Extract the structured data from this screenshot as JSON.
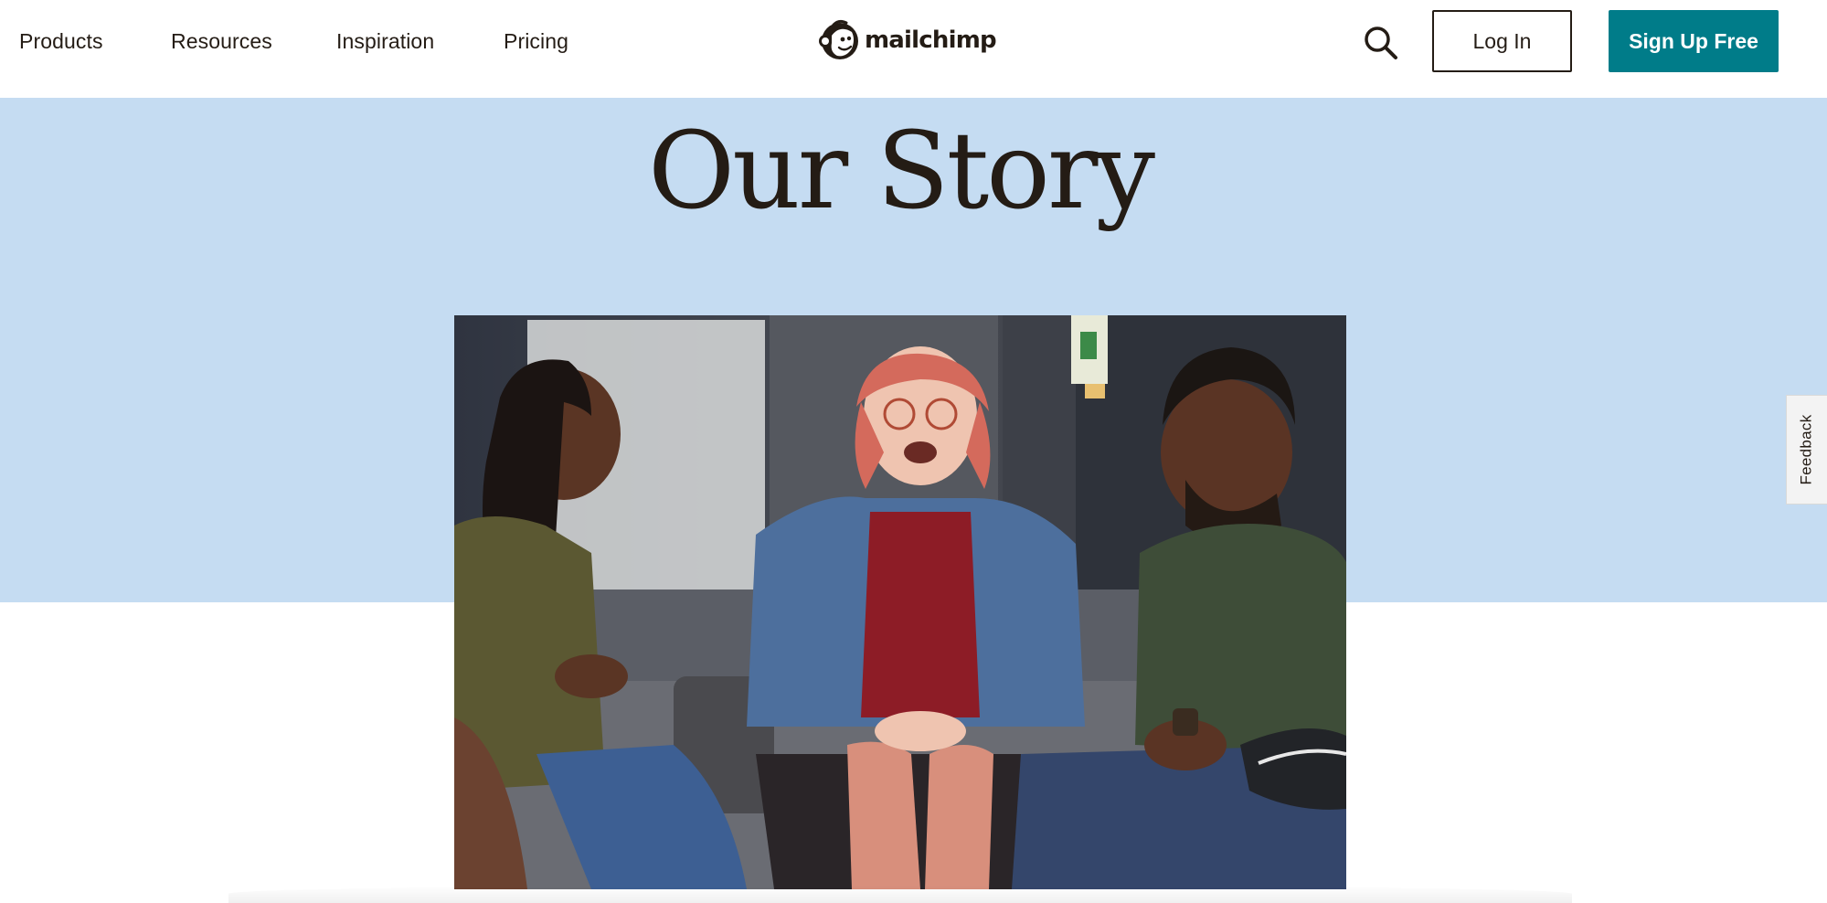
{
  "header": {
    "nav": [
      {
        "label": "Products"
      },
      {
        "label": "Resources"
      },
      {
        "label": "Inspiration"
      },
      {
        "label": "Pricing"
      }
    ],
    "logo_text": "mailchimp",
    "search_icon": "search-icon",
    "login_label": "Log In",
    "signup_label": "Sign Up Free"
  },
  "hero": {
    "title": "Our Story",
    "background_color": "#c5dcf2"
  },
  "feedback": {
    "label": "Feedback"
  },
  "colors": {
    "brand_teal": "#007c89",
    "text_dark": "#241c15"
  }
}
